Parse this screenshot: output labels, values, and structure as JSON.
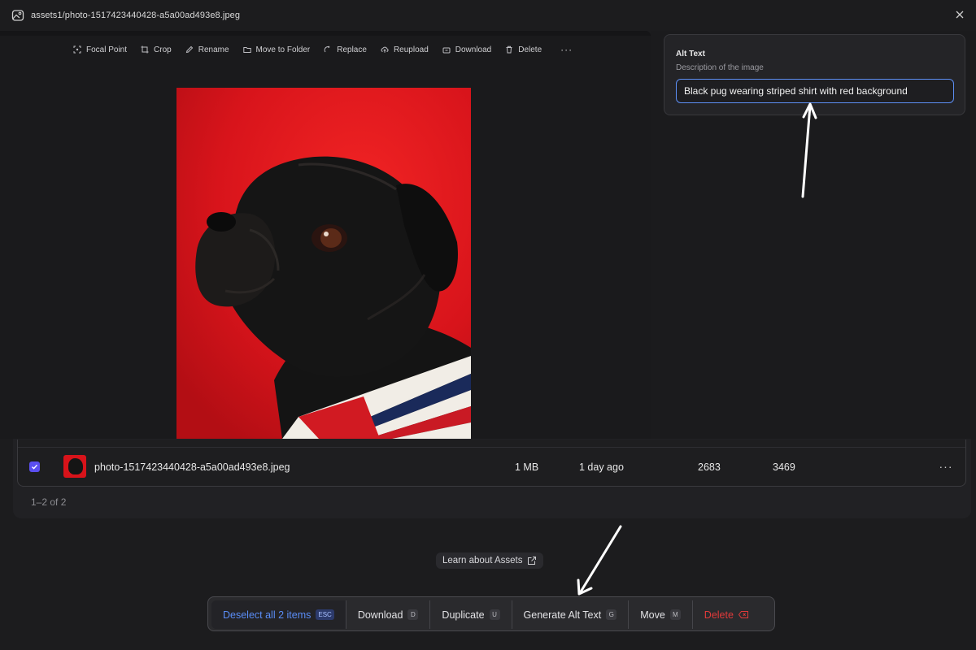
{
  "titlebar": {
    "path": "assets1/photo-1517423440428-a5a00ad493e8.jpeg"
  },
  "toolbar": {
    "focal_point": "Focal Point",
    "crop": "Crop",
    "rename": "Rename",
    "move_to_folder": "Move to Folder",
    "replace": "Replace",
    "reupload": "Reupload",
    "download": "Download",
    "delete": "Delete",
    "more": "···"
  },
  "alt_text": {
    "title": "Alt Text",
    "description": "Description of the image",
    "value": "Black pug wearing striped shirt with red background"
  },
  "table": {
    "rows": [
      {
        "name": "photo-1517423440428-a5a00ad493e8.jpeg",
        "size": "1 MB",
        "date": "1 day ago",
        "width": "2683",
        "height": "3469",
        "more": "···"
      }
    ],
    "pagination": "1–2 of 2"
  },
  "learn": {
    "label": "Learn about Assets"
  },
  "actionbar": {
    "deselect": {
      "label": "Deselect all 2 items",
      "key": "ESC"
    },
    "download": {
      "label": "Download",
      "key": "D"
    },
    "duplicate": {
      "label": "Duplicate",
      "key": "U"
    },
    "generate_alt": {
      "label": "Generate Alt Text",
      "key": "G"
    },
    "move": {
      "label": "Move",
      "key": "M"
    },
    "delete": {
      "label": "Delete"
    }
  },
  "colors": {
    "accent": "#5a8df7",
    "checkbox": "#5b4ff0",
    "danger": "#e23a3a",
    "photo_background": "#d6141a"
  }
}
